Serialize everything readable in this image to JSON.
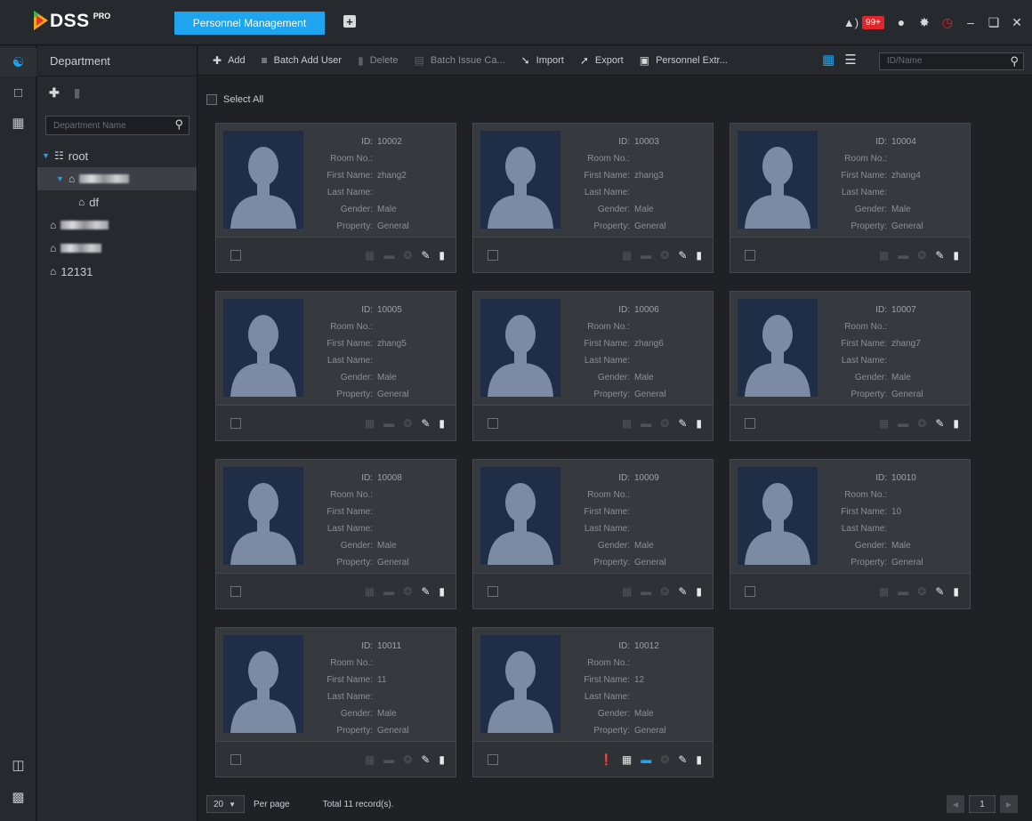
{
  "app": {
    "logo": "DSS",
    "logo_sup": "PRO"
  },
  "tabs": [
    {
      "label": "Personnel Management"
    }
  ],
  "titlebar": {
    "alarm_count": "99+"
  },
  "department": {
    "title": "Department",
    "search_placeholder": "Department Name",
    "tree": {
      "root": "root",
      "df": "df",
      "n12131": "12131"
    }
  },
  "toolbar": {
    "add": "Add",
    "batch_add": "Batch Add User",
    "delete": "Delete",
    "batch_issue": "Batch Issue Ca...",
    "import": "Import",
    "export": "Export",
    "extract": "Personnel Extr...",
    "search_placeholder": "ID/Name"
  },
  "select_all": "Select All",
  "labels": {
    "id": "ID:",
    "room": "Room No.:",
    "first": "First Name:",
    "last": "Last Name:",
    "gender": "Gender:",
    "property": "Property:"
  },
  "persons": [
    {
      "id": "10002",
      "room": "",
      "first": "zhang2",
      "last": "",
      "gender": "Male",
      "property": "General"
    },
    {
      "id": "10003",
      "room": "",
      "first": "zhang3",
      "last": "",
      "gender": "Male",
      "property": "General"
    },
    {
      "id": "10004",
      "room": "",
      "first": "zhang4",
      "last": "",
      "gender": "Male",
      "property": "General"
    },
    {
      "id": "10005",
      "room": "",
      "first": "zhang5",
      "last": "",
      "gender": "Male",
      "property": "General"
    },
    {
      "id": "10006",
      "room": "",
      "first": "zhang6",
      "last": "",
      "gender": "Male",
      "property": "General"
    },
    {
      "id": "10007",
      "room": "",
      "first": "zhang7",
      "last": "",
      "gender": "Male",
      "property": "General"
    },
    {
      "id": "10008",
      "room": "",
      "first": "",
      "last": "",
      "gender": "Male",
      "property": "General"
    },
    {
      "id": "10009",
      "room": "",
      "first": "",
      "last": "",
      "gender": "Male",
      "property": "General"
    },
    {
      "id": "10010",
      "room": "",
      "first": "10",
      "last": "",
      "gender": "Male",
      "property": "General"
    },
    {
      "id": "10011",
      "room": "",
      "first": "11",
      "last": "",
      "gender": "Male",
      "property": "General"
    },
    {
      "id": "10012",
      "room": "",
      "first": "12",
      "last": "",
      "gender": "Male",
      "property": "General"
    }
  ],
  "footer": {
    "per_page": "20",
    "per_page_label": "Per page",
    "total": "Total 11 record(s).",
    "page": "1"
  }
}
